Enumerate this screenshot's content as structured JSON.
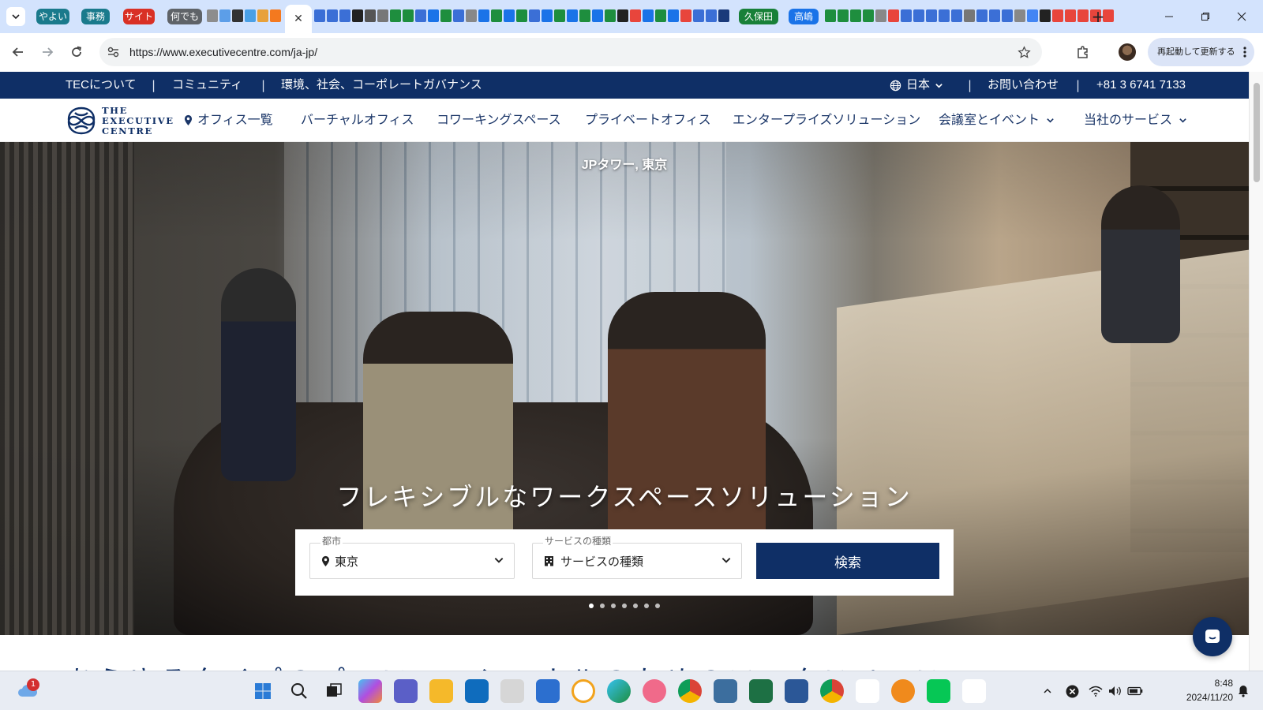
{
  "browser": {
    "tab_groups": [
      {
        "label": "やよい",
        "color": "#1a7a8c"
      },
      {
        "label": "事務",
        "color": "#1a7a8c"
      },
      {
        "label": "サイト",
        "color": "#d93025"
      },
      {
        "label": "何でも",
        "color": "#5f6368"
      },
      {
        "label": "久保田",
        "color": "#188038"
      },
      {
        "label": "高嶋",
        "color": "#1a73e8"
      }
    ],
    "active_tab_close": "✕",
    "new_tab": "+",
    "url": "https://www.executivecentre.com/ja-jp/",
    "relaunch_label": "再起動して更新する"
  },
  "utility_bar": {
    "about": "TECについて",
    "community": "コミュニティ",
    "esg": "環境、社会、コーポレートガバナンス",
    "language": "日本",
    "contact": "お問い合わせ",
    "phone": "+81 3 6741 7133",
    "separator": "|"
  },
  "logo": {
    "line1": "THE",
    "line2": "EXECUTIVE",
    "line3": "CENTRE"
  },
  "main_nav": {
    "offices": "オフィス一覧",
    "virtual": "バーチャルオフィス",
    "coworking": "コワーキングスペース",
    "private": "プライベートオフィス",
    "enterprise": "エンタープライズソリューション",
    "meeting": "会議室とイベント",
    "services": "当社のサービス"
  },
  "hero": {
    "location": "JPタワー, 東京",
    "headline": "フレキシブルなワークスペースソリューション",
    "dots_total": 7,
    "dots_active": 0
  },
  "search": {
    "city_label": "都市",
    "city_value": "東京",
    "service_label": "サービスの種類",
    "service_value": "サービスの種類",
    "button": "検索"
  },
  "below_heading": "あらゆるタイプのプロフェッショナルのためのワークスペース",
  "taskbar": {
    "weather_badge": "1",
    "time": "8:48",
    "date": "2024/11/20"
  }
}
